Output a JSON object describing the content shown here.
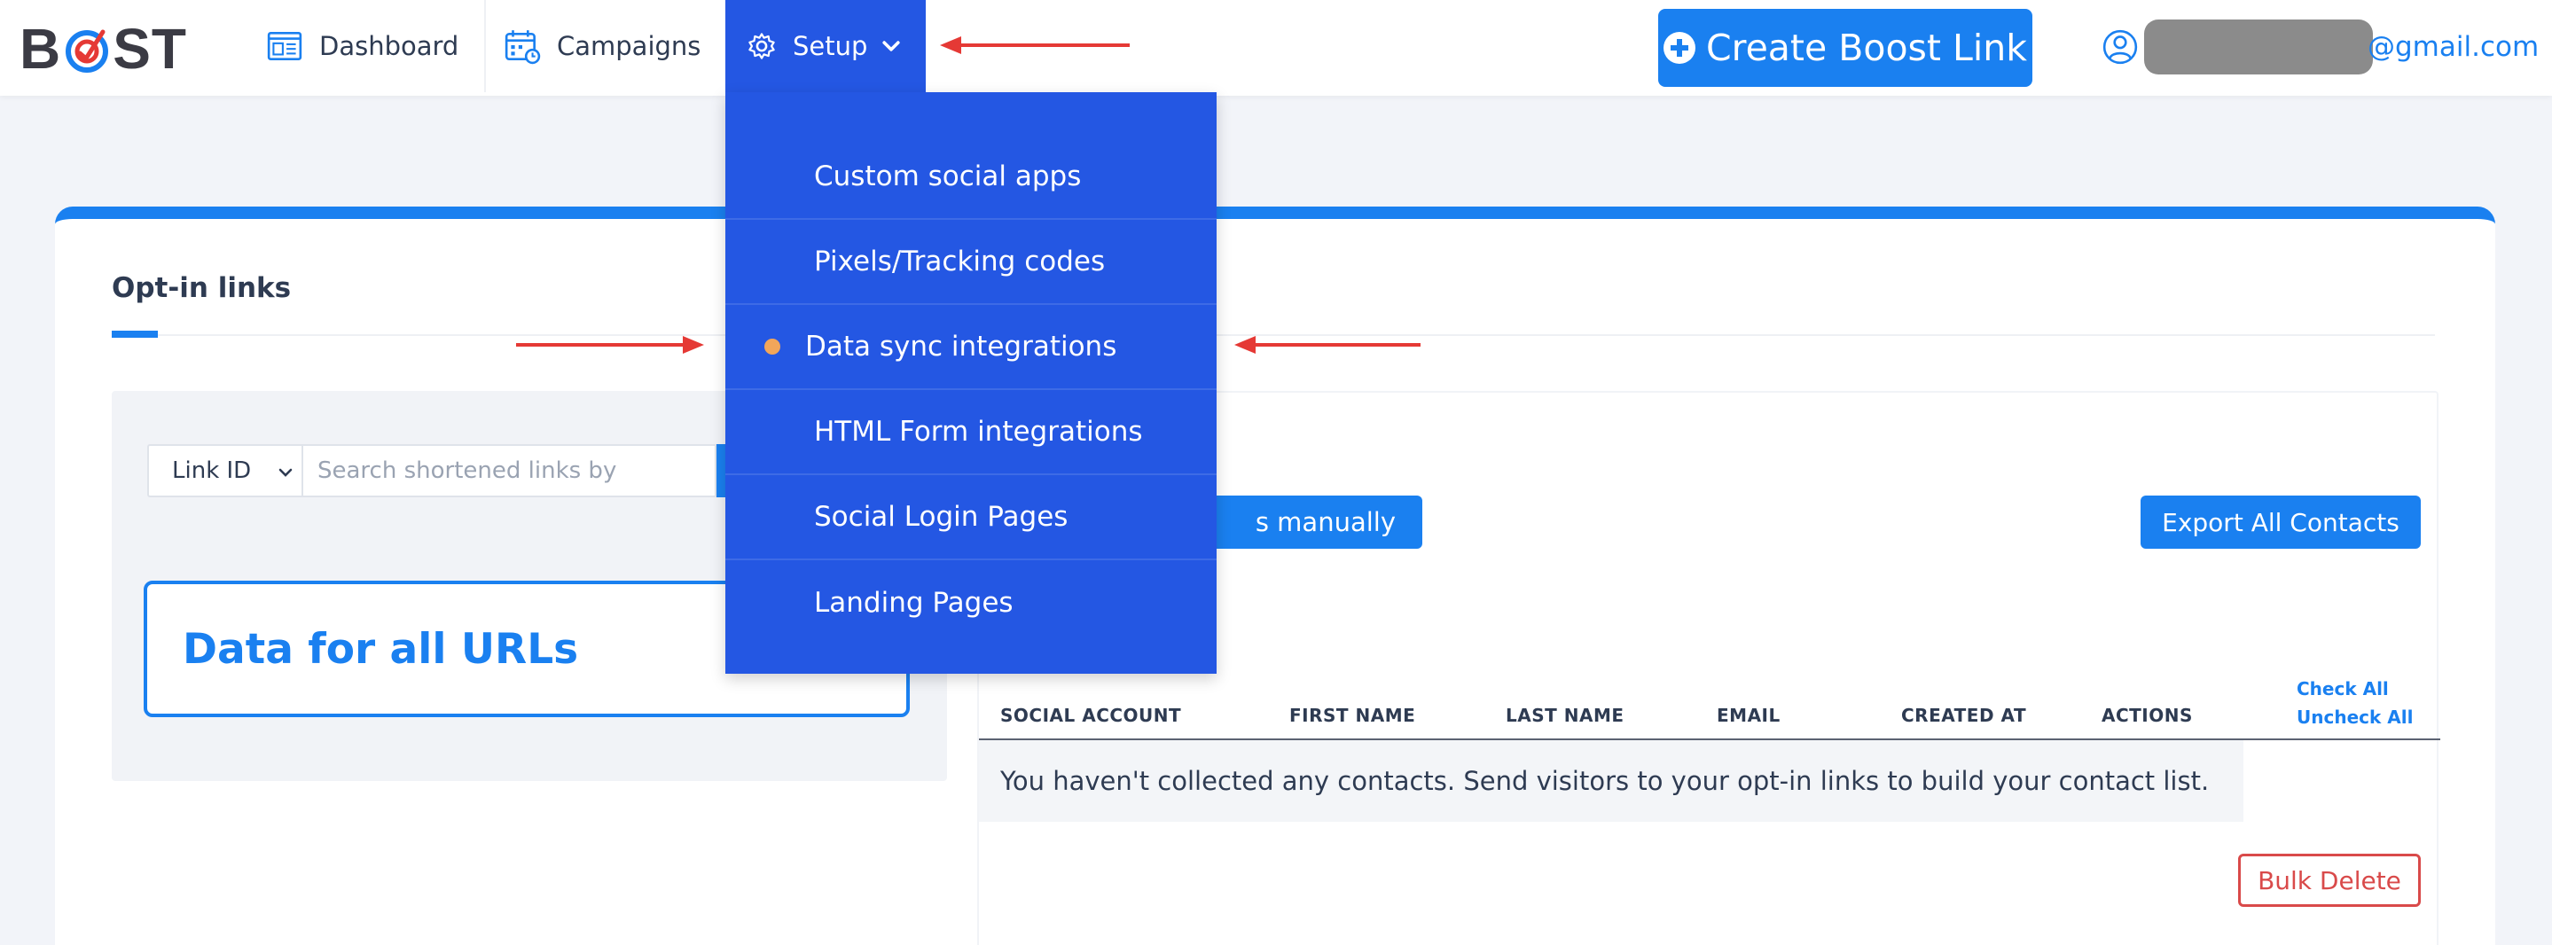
{
  "brand": {
    "logo_text_left": "B",
    "logo_text_right": "ST"
  },
  "nav": {
    "dashboard_label": "Dashboard",
    "campaigns_label": "Campaigns",
    "setup_label": "Setup"
  },
  "header": {
    "create_label": "Create Boost Link",
    "user_email_suffix": "@gmail.com"
  },
  "dropdown": {
    "items": [
      {
        "label": "Custom social apps"
      },
      {
        "label": "Pixels/Tracking codes"
      },
      {
        "label": "Data sync integrations",
        "active": true
      },
      {
        "label": "HTML Form integrations"
      },
      {
        "label": "Social Login Pages"
      },
      {
        "label": "Landing Pages"
      }
    ]
  },
  "main": {
    "tab_label": "Opt-in links",
    "filter": {
      "selected": "Link ID",
      "placeholder": "Search shortened links by"
    },
    "data_box_label": "Data for all URLs",
    "add_manual_label_partial": "s manually",
    "export_label": "Export All Contacts",
    "table": {
      "headers": [
        "SOCIAL ACCOUNT",
        "FIRST NAME",
        "LAST NAME",
        "EMAIL",
        "CREATED AT",
        "ACTIONS"
      ],
      "check_all": "Check All",
      "uncheck_all": "Uncheck All",
      "empty_message": "You haven't collected any contacts. Send visitors to your opt-in links to build your contact list."
    },
    "bulk_delete_label": "Bulk Delete"
  },
  "colors": {
    "accent": "#1a80f0",
    "dropdown_bg": "#2457e3",
    "active_dot": "#f2a65a",
    "danger": "#d94a4a",
    "annotation_arrow": "#e53935"
  }
}
